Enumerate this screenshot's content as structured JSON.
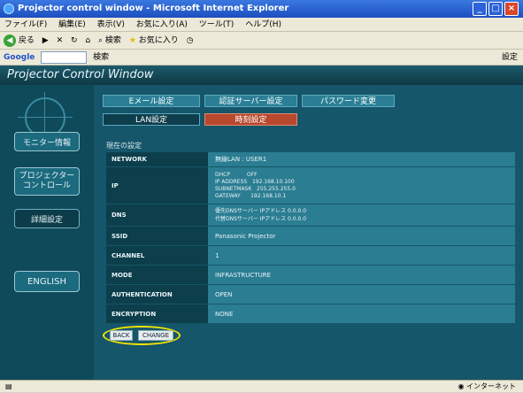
{
  "window": {
    "title": "Projector control window - Microsoft Internet Explorer"
  },
  "menubar": {
    "items": [
      "ファイル(F)",
      "編集(E)",
      "表示(V)",
      "お気に入り(A)",
      "ツール(T)",
      "ヘルプ(H)"
    ]
  },
  "toolbar": {
    "back_label": "戻る",
    "search_label": "検索",
    "favorites_label": "お気に入り"
  },
  "googlebar": {
    "logo": "Google",
    "search_label": "検索",
    "settings_label": "設定"
  },
  "app": {
    "title": "Projector Control Window"
  },
  "nav": {
    "monitor": "モニター情報",
    "projector_control": "プロジェクター\nコントロール",
    "detail_settings": "詳細設定",
    "english": "ENGLISH"
  },
  "tabs": {
    "email": "Eメール設定",
    "auth_server": "認証サーバー設定",
    "password": "パスワード変更",
    "lan": "LAN設定",
    "time": "時刻設定"
  },
  "section": {
    "title": "現在の設定"
  },
  "settings": [
    {
      "key": "NETWORK",
      "lines": [
        "無線LAN : USER1"
      ]
    },
    {
      "key": "IP",
      "lines": [
        "DHCP          OFF",
        "IP ADDRESS   192.168.10.100",
        "SUBNETMASK   255.255.255.0",
        "GATEWAY      192.168.10.1"
      ]
    },
    {
      "key": "DNS",
      "lines": [
        "優先DNSサーバー IPアドレス  0.0.0.0",
        "代替DNSサーバー IPアドレス  0.0.0.0"
      ]
    },
    {
      "key": "SSID",
      "lines": [
        "Panasonic Projector"
      ]
    },
    {
      "key": "CHANNEL",
      "lines": [
        "1"
      ]
    },
    {
      "key": "MODE",
      "lines": [
        "INFRASTRUCTURE"
      ]
    },
    {
      "key": "AUTHENTICATION",
      "lines": [
        "OPEN"
      ]
    },
    {
      "key": "ENCRYPTION",
      "lines": [
        "NONE"
      ]
    }
  ],
  "actions": {
    "back": "BACK",
    "change": "CHANGE"
  },
  "statusbar": {
    "zone": "インターネット"
  }
}
